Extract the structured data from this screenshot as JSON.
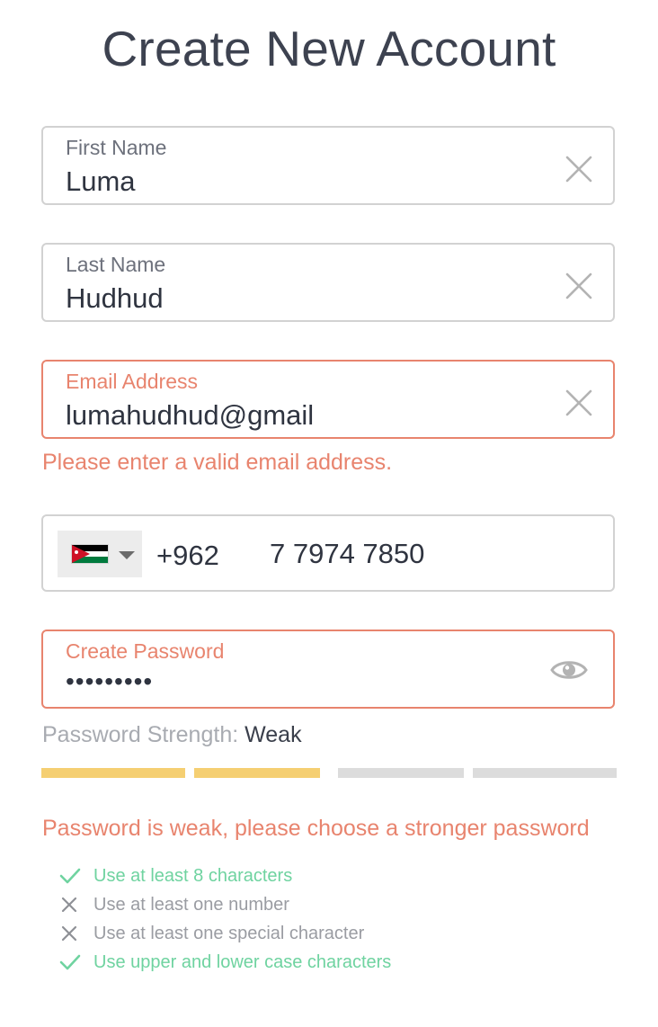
{
  "title": "Create New Account",
  "first_name": {
    "label": "First Name",
    "value": "Luma"
  },
  "last_name": {
    "label": "Last Name",
    "value": "Hudhud"
  },
  "email": {
    "label": "Email Address",
    "value": "lumahudhud@gmail",
    "error": "Please enter a valid email address."
  },
  "phone": {
    "country_flag": "jordan-flag",
    "dial_code": "+962",
    "number": "7 7974 7850"
  },
  "password": {
    "label": "Create Password",
    "value": "•••••••••",
    "strength_label": "Password Strength:",
    "strength_value": "Weak",
    "strength_level": 0.5,
    "error": "Password is weak, please choose a stronger password",
    "requirements": [
      {
        "text": "Use at least 8 characters",
        "met": true
      },
      {
        "text": "Use at least one number",
        "met": false
      },
      {
        "text": "Use at least one special character",
        "met": false
      },
      {
        "text": "Use upper and lower case characters",
        "met": true
      }
    ]
  },
  "colors": {
    "error": "#e8846e",
    "success": "#6fd3a0",
    "strength_active": "#f5cf72",
    "strength_inactive": "#dcdcdc",
    "border": "#d2d2d2"
  }
}
